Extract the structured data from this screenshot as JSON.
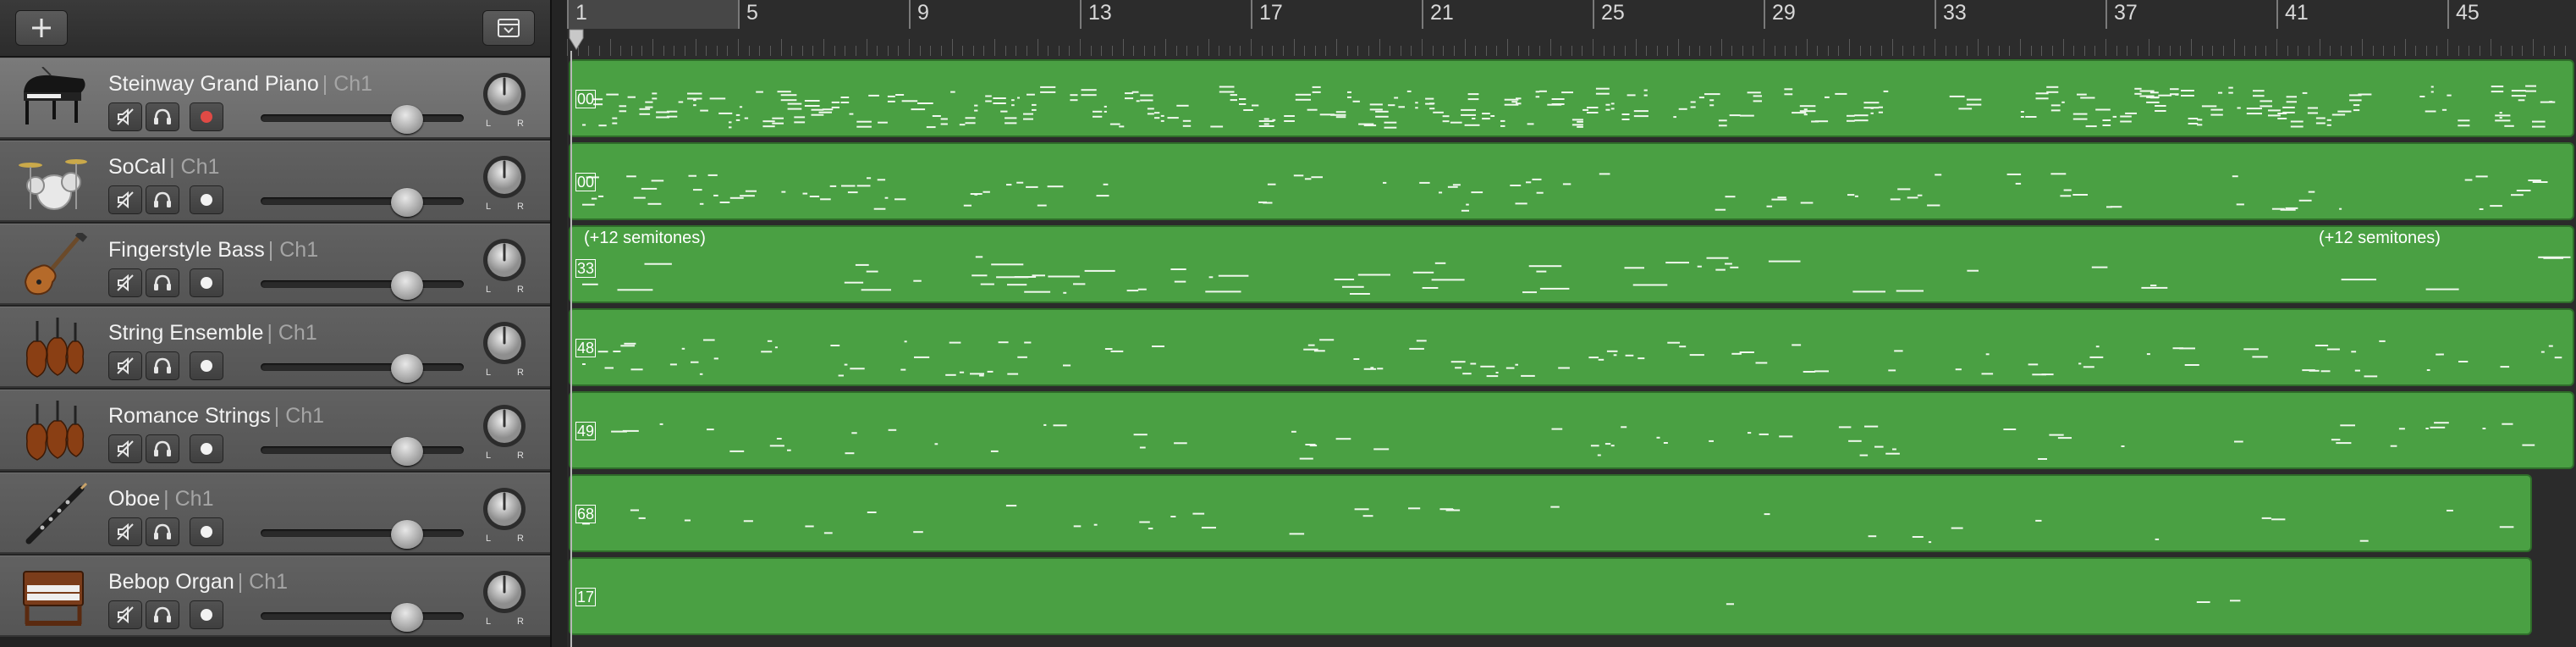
{
  "toolbar": {
    "add_track_icon": "plus-icon",
    "library_icon": "tray-down-icon"
  },
  "ruler": {
    "bar_numbers": [
      "1",
      "5",
      "9",
      "13",
      "17",
      "21",
      "25",
      "29",
      "33",
      "37",
      "41",
      "45"
    ]
  },
  "tracks": [
    {
      "name": "Steinway Grand Piano",
      "channel": "| Ch1",
      "icon": "grand-piano-icon",
      "record_armed": true,
      "selected": true,
      "volume": 0.72
    },
    {
      "name": "SoCal",
      "channel": "| Ch1",
      "icon": "drum-kit-icon",
      "record_armed": false,
      "selected": false,
      "volume": 0.72
    },
    {
      "name": "Fingerstyle Bass",
      "channel": "| Ch1",
      "icon": "bass-guitar-icon",
      "record_armed": false,
      "selected": false,
      "volume": 0.72
    },
    {
      "name": "String Ensemble",
      "channel": "| Ch1",
      "icon": "cello-icon",
      "record_armed": false,
      "selected": false,
      "volume": 0.72
    },
    {
      "name": "Romance Strings",
      "channel": "| Ch1",
      "icon": "cello-icon",
      "record_armed": false,
      "selected": false,
      "volume": 0.72
    },
    {
      "name": "Oboe",
      "channel": "| Ch1",
      "icon": "oboe-icon",
      "record_armed": false,
      "selected": false,
      "volume": 0.72
    },
    {
      "name": "Bebop Organ",
      "channel": "| Ch1",
      "icon": "organ-icon",
      "record_armed": false,
      "selected": false,
      "volume": 0.72
    }
  ],
  "pan_labels": {
    "left": "L",
    "right": "R"
  },
  "regions": [
    {
      "label": "00",
      "note_left": "",
      "note_right": "",
      "color": "#4aa043"
    },
    {
      "label": "00",
      "note_left": "",
      "note_right": "",
      "color": "#4aa043"
    },
    {
      "label": "33",
      "note_left": "(+12 semitones)",
      "note_right": "(+12 semitones)",
      "color": "#4aa043"
    },
    {
      "label": "48",
      "note_left": "",
      "note_right": "",
      "color": "#4aa043"
    },
    {
      "label": "49",
      "note_left": "",
      "note_right": "",
      "color": "#4aa043"
    },
    {
      "label": "68",
      "note_left": "",
      "note_right": "",
      "color": "#4aa043"
    },
    {
      "label": "17",
      "note_left": "",
      "note_right": "",
      "color": "#4aa043"
    }
  ]
}
